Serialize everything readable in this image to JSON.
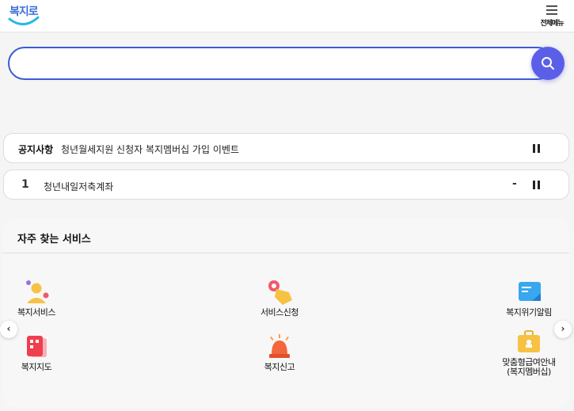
{
  "header": {
    "logo_text": "복지로",
    "menu_label": "전체메뉴"
  },
  "search": {
    "placeholder": "",
    "value": ""
  },
  "notice": {
    "title": "공지사항",
    "text": "청년월세지원 신청자 복지멤버십 가입 이벤트"
  },
  "keyword": {
    "rank": "1",
    "text": "청년내일저축계좌",
    "change": "-"
  },
  "services": {
    "title": "자주 찾는 서비스",
    "items": [
      {
        "label": "복지서비스",
        "icon": "person-icon"
      },
      {
        "label": "서비스신청",
        "icon": "hand-click-icon"
      },
      {
        "label": "복지위기알림",
        "icon": "message-card-icon"
      },
      {
        "label": "복지지도",
        "icon": "map-grid-icon"
      },
      {
        "label": "복지신고",
        "icon": "siren-icon"
      },
      {
        "label": "맞춤형급여안내",
        "label2": "(복지멤버십)",
        "icon": "briefcase-icon"
      }
    ]
  },
  "colors": {
    "brand_blue": "#3b5bd6",
    "search_button": "#5b5fe8"
  }
}
